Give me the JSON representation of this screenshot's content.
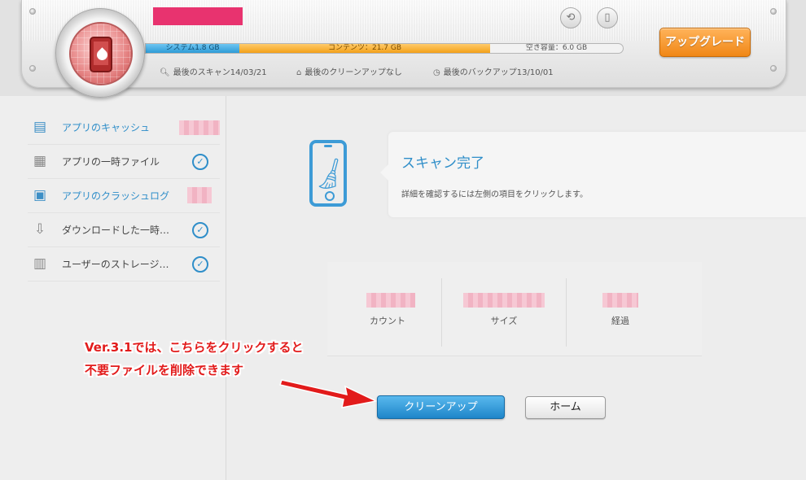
{
  "header": {
    "storage": {
      "system_label": "システム1.8 GB",
      "content_label": "コンテンツ：21.7 GB",
      "free_label": "空き容量：6.0 GB"
    },
    "status": {
      "last_scan": "最後のスキャン14/03/21",
      "last_cleanup": "最後のクリーンアップなし",
      "last_backup": "最後のバックアップ13/10/01"
    },
    "upgrade_label": "アップグレード"
  },
  "sidebar": {
    "items": [
      {
        "label": "アプリのキャッシュ",
        "icon": "app-cache-icon",
        "highlight": true
      },
      {
        "label": "アプリの一時ファイル",
        "icon": "temp-file-icon",
        "highlight": false
      },
      {
        "label": "アプリのクラッシュログ",
        "icon": "crash-log-icon",
        "highlight": true
      },
      {
        "label": "ダウンロードした一時…",
        "icon": "download-icon",
        "highlight": false
      },
      {
        "label": "ユーザーのストレージ…",
        "icon": "storage-icon",
        "highlight": false
      }
    ]
  },
  "main": {
    "title": "スキャン完了",
    "description": "詳細を確認するには左側の項目をクリックします。",
    "stats": {
      "count_label": "カウント",
      "size_label": "サイズ",
      "elapsed_label": "経過"
    },
    "cleanup_label": "クリーンアップ",
    "home_label": "ホーム"
  },
  "annotation": {
    "line1": "Ver.3.1では、こちらをクリックすると",
    "line2": "不要ファイルを削除できます"
  },
  "colors": {
    "accent_blue": "#2f8ec9",
    "upgrade_orange": "#f08716",
    "annotation_red": "#e21b1b",
    "title_block_pink": "#e8336f"
  }
}
